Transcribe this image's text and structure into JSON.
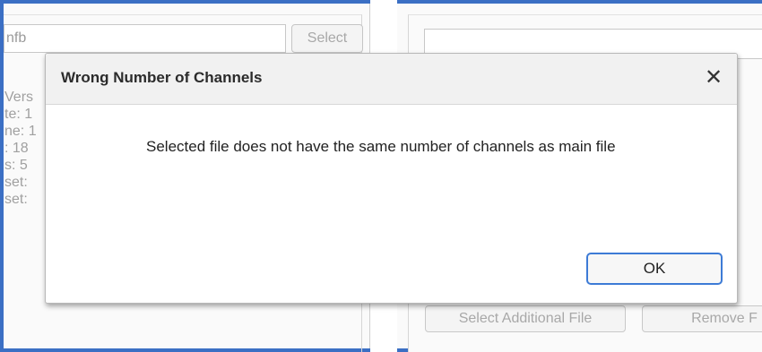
{
  "left_panel": {
    "file_name": "nfb",
    "select_label": "Select",
    "info_lines": [
      "Vers",
      "te: 1",
      "ne: 1",
      ": 18",
      "s: 5",
      "set:",
      "set:"
    ]
  },
  "right_panel": {
    "file_value": "",
    "select_additional_label": "Select Additional File",
    "remove_label": "Remove F"
  },
  "dialog": {
    "title": "Wrong Number of Channels",
    "close_glyph": "✕",
    "message": "Selected file does not have the same number of channels as main file",
    "ok_label": "OK"
  },
  "colors": {
    "frame": "#3b6fc4",
    "ok_border": "#3d7bd6"
  }
}
